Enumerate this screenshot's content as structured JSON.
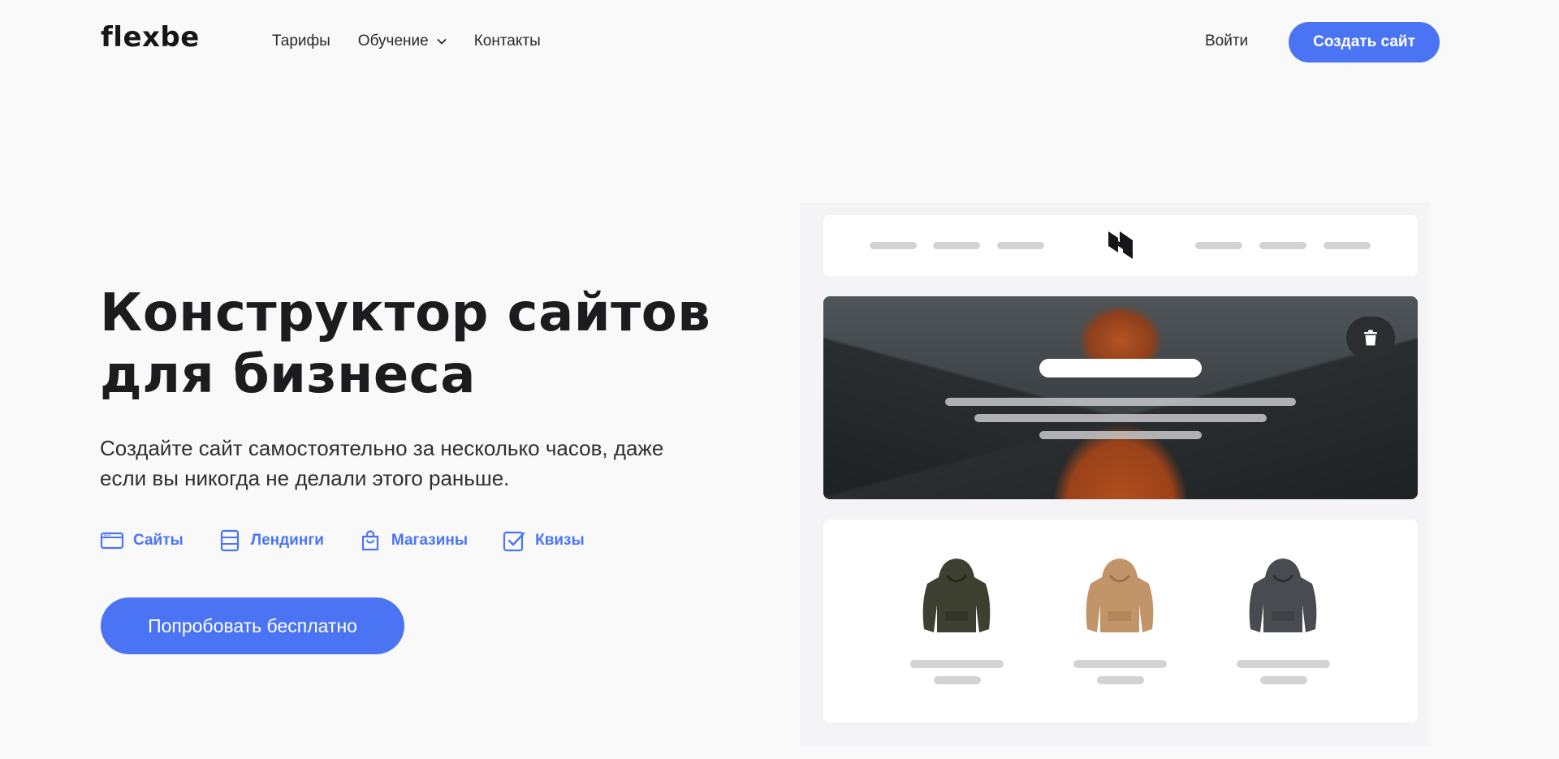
{
  "header": {
    "logo": "flexbe",
    "nav": [
      {
        "label": "Тарифы"
      },
      {
        "label": "Обучение",
        "has_dropdown": true
      },
      {
        "label": "Контакты"
      }
    ],
    "login_label": "Войти",
    "cta_label": "Создать сайт"
  },
  "hero": {
    "title_line1": "Конструктор сайтов",
    "title_line2": "для бизнеса",
    "subtitle_line1": "Создайте сайт самостоятельно за несколько часов, даже",
    "subtitle_line2": "если вы никогда не делали этого раньше.",
    "features": [
      {
        "label": "Сайты",
        "icon": "browser-window-icon"
      },
      {
        "label": "Лендинги",
        "icon": "landing-layout-icon"
      },
      {
        "label": "Магазины",
        "icon": "shopping-bag-icon"
      },
      {
        "label": "Квизы",
        "icon": "checkbox-icon"
      }
    ],
    "cta_label": "Попробовать бесплатно"
  },
  "mockup": {
    "products": [
      {
        "icon": "hoodie-olive-icon",
        "color": "#3d3f30"
      },
      {
        "icon": "hoodie-tan-icon",
        "color": "#c1946a"
      },
      {
        "icon": "hoodie-charcoal-icon",
        "color": "#4a4b50"
      }
    ]
  },
  "colors": {
    "accent": "#4b74f5",
    "background": "#f9f9fa",
    "text": "#1c1c1e"
  }
}
